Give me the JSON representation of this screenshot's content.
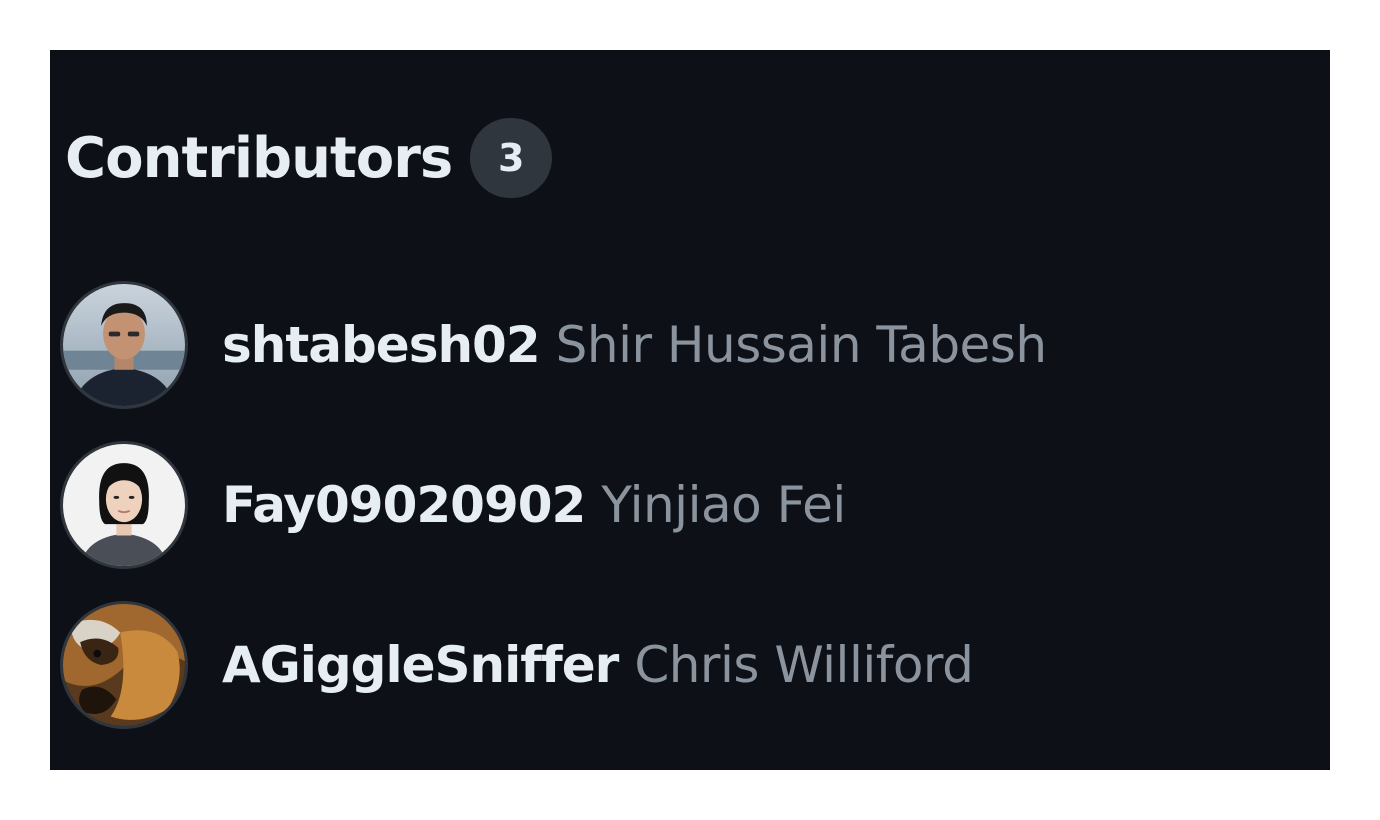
{
  "contributors": {
    "title": "Contributors",
    "count": "3",
    "items": [
      {
        "login": "shtabesh02",
        "name": "Shir Hussain Tabesh"
      },
      {
        "login": "Fay09020902",
        "name": "Yinjiao Fei"
      },
      {
        "login": "AGiggleSniffer",
        "name": "Chris Williford"
      }
    ]
  },
  "colors": {
    "panel_bg": "#0d1117",
    "text_primary": "#e6edf3",
    "text_secondary": "#8b949e",
    "badge_bg": "#30363d"
  }
}
